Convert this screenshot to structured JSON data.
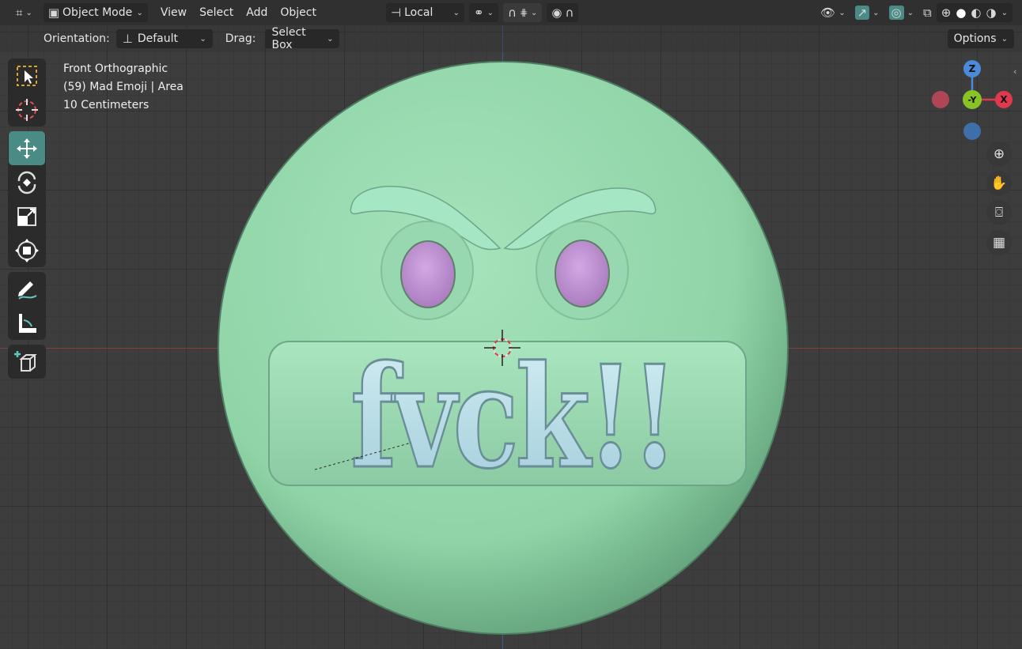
{
  "header": {
    "editor_type_icon": "axis-gizmo-icon",
    "mode": "Object Mode",
    "menus": [
      "View",
      "Select",
      "Add",
      "Object"
    ],
    "transform_orientation": "Local",
    "pivot_icon": "pivot-link-icon",
    "snap_icon": "magnet-icon",
    "snap_increment_icon": "snap-increment-icon",
    "proportional_icon": "proportional-edit-icon",
    "falloff_icon": "falloff-curve-icon",
    "visibility_icon": "eye-icon",
    "gizmo_icon": "gizmo-arrow-icon",
    "overlay_icon": "overlay-circles-icon",
    "xray_icon": "xray-icon",
    "shading_modes": [
      "wireframe",
      "solid",
      "material-preview",
      "rendered"
    ],
    "active_shading": "solid"
  },
  "tool_settings": {
    "orientation_label": "Orientation:",
    "orientation_value": "Default",
    "drag_label": "Drag:",
    "drag_value": "Select Box",
    "options_label": "Options"
  },
  "overlay": {
    "view_name": "Front Orthographic",
    "object_info": "(59) Mad Emoji | Area",
    "scale": "10 Centimeters"
  },
  "toolbar": [
    {
      "name": "select-box-tool",
      "icon": "select-box-icon"
    },
    {
      "name": "cursor-tool",
      "icon": "cursor-icon"
    },
    {
      "name": "move-tool",
      "icon": "move-icon",
      "active": true
    },
    {
      "name": "rotate-tool",
      "icon": "rotate-icon"
    },
    {
      "name": "scale-tool",
      "icon": "scale-icon"
    },
    {
      "name": "transform-tool",
      "icon": "transform-icon"
    },
    {
      "name": "annotate-tool",
      "icon": "annotate-icon"
    },
    {
      "name": "measure-tool",
      "icon": "measure-icon"
    },
    {
      "name": "add-cube-tool",
      "icon": "add-cube-icon"
    }
  ],
  "gizmo": {
    "z_label": "Z",
    "y_label": "-Y",
    "x_label": "X",
    "colors": {
      "z": "#4a8ad6",
      "y": "#88c425",
      "x": "#e0394d"
    }
  },
  "nav_buttons": [
    "zoom-icon",
    "hand-pan-icon",
    "camera-icon",
    "ortho-grid-icon"
  ],
  "model": {
    "text": "fvck!!",
    "colors": {
      "face": "#8fd4a7",
      "eyes": "#c596d9",
      "letters": "#b8dde8"
    }
  },
  "colors": {
    "header_bg": "#303030",
    "viewport_bg": "#3d3d3d",
    "active_tool": "#4b8b85",
    "x_axis": "#8c3a42",
    "z_axis": "#3e5a86"
  }
}
